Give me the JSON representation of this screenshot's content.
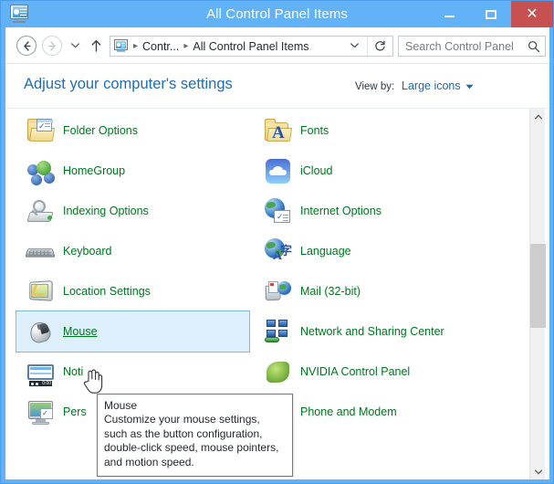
{
  "window": {
    "title": "All Control Panel Items",
    "icon": "control-panel-monitor-icon",
    "minimize_label": "–",
    "maximize_label": "▭",
    "close_label": "✕",
    "accent_color": "#62b2f7",
    "close_color": "#c75050"
  },
  "nav": {
    "back_label": "←",
    "forward_label": "→",
    "recent_label": "▾",
    "up_label": "↑",
    "breadcrumb": {
      "sep": "▸",
      "items": [
        "Contr...",
        "All Control Panel Items"
      ]
    },
    "dropdown_label": "⌄",
    "refresh_label": "↻"
  },
  "search": {
    "placeholder": "Search Control Panel",
    "icon": "search-icon"
  },
  "header": {
    "page_title": "Adjust your computer's settings",
    "view_by_label": "View by:",
    "view_by_value": "Large icons",
    "view_by_arrow": "▼",
    "title_color": "#1f6cb8",
    "link_color": "#00761f"
  },
  "items": [
    {
      "label": "Folder Options",
      "icon": "folder-options-icon",
      "col": 0,
      "row": 0,
      "selected": false
    },
    {
      "label": "Fonts",
      "icon": "fonts-icon",
      "col": 1,
      "row": 0,
      "selected": false
    },
    {
      "label": "HomeGroup",
      "icon": "homegroup-icon",
      "col": 0,
      "row": 1,
      "selected": false
    },
    {
      "label": "iCloud",
      "icon": "icloud-icon",
      "col": 1,
      "row": 1,
      "selected": false
    },
    {
      "label": "Indexing Options",
      "icon": "indexing-options-icon",
      "col": 0,
      "row": 2,
      "selected": false
    },
    {
      "label": "Internet Options",
      "icon": "internet-options-icon",
      "col": 1,
      "row": 2,
      "selected": false
    },
    {
      "label": "Keyboard",
      "icon": "keyboard-icon",
      "col": 0,
      "row": 3,
      "selected": false
    },
    {
      "label": "Language",
      "icon": "language-icon",
      "col": 1,
      "row": 3,
      "selected": false
    },
    {
      "label": "Location Settings",
      "icon": "location-settings-icon",
      "col": 0,
      "row": 4,
      "selected": false
    },
    {
      "label": "Mail (32-bit)",
      "icon": "mail-icon",
      "col": 1,
      "row": 4,
      "selected": false
    },
    {
      "label": "Mouse",
      "icon": "mouse-icon",
      "col": 0,
      "row": 5,
      "selected": true
    },
    {
      "label": "Network and Sharing Center",
      "icon": "network-sharing-center-icon",
      "col": 1,
      "row": 5,
      "selected": false
    },
    {
      "label": "Noti",
      "icon": "notification-area-icons-icon",
      "col": 0,
      "row": 6,
      "selected": false
    },
    {
      "label": "NVIDIA Control Panel",
      "icon": "nvidia-control-panel-icon",
      "col": 1,
      "row": 6,
      "selected": false
    },
    {
      "label": "Pers",
      "icon": "personalization-icon",
      "col": 0,
      "row": 7,
      "selected": false
    },
    {
      "label": "Phone and Modem",
      "icon": "phone-and-modem-icon",
      "col": 1,
      "row": 7,
      "selected": false
    }
  ],
  "tooltip": {
    "title": "Mouse",
    "body": "Customize your mouse settings, such as the button configuration, double-click speed, mouse pointers, and motion speed."
  },
  "scrollbar": {
    "up_label": "∧",
    "down_label": "∨"
  }
}
